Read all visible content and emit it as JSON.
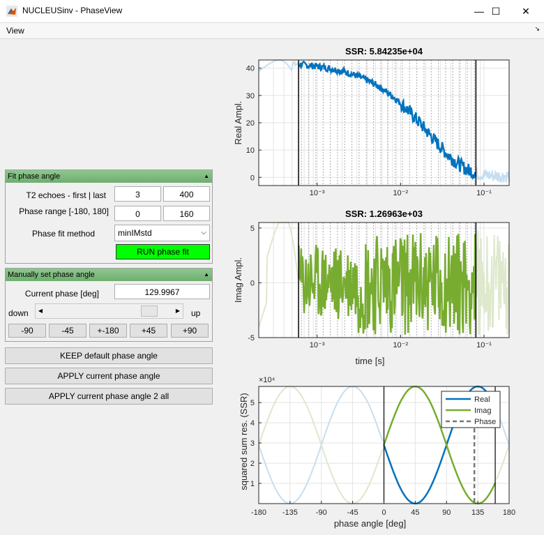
{
  "window": {
    "title": "NUCLEUSinv - PhaseView",
    "minimize_glyph": "—",
    "maximize_glyph": "☐",
    "close_glyph": "✕"
  },
  "menu": {
    "view_label": "View",
    "overflow_glyph": "↘"
  },
  "fit_panel": {
    "title": "Fit phase angle",
    "echoes_label": "T2 echoes - first | last",
    "echoes_first": "3",
    "echoes_last": "400",
    "range_label": "Phase range [-180, 180]",
    "range_min": "0",
    "range_max": "160",
    "method_label": "Phase fit method",
    "method_value": "minIMstd",
    "run_label": "RUN phase fit"
  },
  "manual_panel": {
    "title": "Manually set phase angle",
    "current_label": "Current phase [deg]",
    "current_value": "129.9967",
    "slider_level": 0.86,
    "down_label": "down",
    "up_label": "up",
    "step_buttons": [
      "-90",
      "-45",
      "+-180",
      "+45",
      "+90"
    ]
  },
  "actions": {
    "keep_label": "KEEP default phase angle",
    "apply_label": "APPLY current phase angle",
    "apply_all_label": "APPLY current phase angle 2 all"
  },
  "colors": {
    "real": "#0072bd",
    "imag": "#77ac30",
    "panel_header": "#7fbf7f",
    "run_button": "#00ff00"
  },
  "chart_data": [
    {
      "type": "line",
      "title": "SSR: 5.84235e+04",
      "ylabel": "Real Ampl.",
      "xscale": "log",
      "xlim": [
        0.0002,
        0.2
      ],
      "ylim": [
        -3,
        43
      ],
      "yticks": [
        "0",
        "10",
        "20",
        "30",
        "40"
      ],
      "xticks": [
        "10⁻³",
        "10⁻²",
        "10⁻¹"
      ],
      "window": [
        0.0006,
        0.08
      ],
      "series": [
        {
          "color": "#0072bd"
        }
      ]
    },
    {
      "type": "line",
      "title": "SSR: 1.26963e+03",
      "ylabel": "Imag Ampl.",
      "xlabel": "time [s]",
      "xscale": "log",
      "xlim": [
        0.0002,
        0.2
      ],
      "ylim": [
        -5,
        5.5
      ],
      "yticks": [
        "-5",
        "0",
        "5"
      ],
      "xticks": [
        "10⁻³",
        "10⁻²",
        "10⁻¹"
      ],
      "window": [
        0.0006,
        0.08
      ],
      "series": [
        {
          "color": "#77ac30"
        }
      ]
    },
    {
      "type": "line",
      "ylabel": "squared sum res. (SSR)",
      "xlabel": "phase angle [deg]",
      "exponent_label": "×10⁴",
      "xlim": [
        -180,
        180
      ],
      "ylim": [
        0,
        5.8
      ],
      "xticks": [
        "-180",
        "-135",
        "-90",
        "-45",
        "0",
        "45",
        "90",
        "135",
        "180"
      ],
      "yticks": [
        "1",
        "2",
        "3",
        "4",
        "5"
      ],
      "window": [
        0,
        160
      ],
      "current_phase": 130,
      "series": [
        {
          "name": "Real",
          "color": "#0072bd",
          "amplitude": 2.9,
          "offset": 2.9,
          "peak_deg": 135
        },
        {
          "name": "Imag",
          "color": "#77ac30",
          "amplitude": 2.9,
          "offset": 2.9,
          "peak_deg": 45
        },
        {
          "name": "Phase",
          "color": "#777777",
          "style": "dashed"
        }
      ]
    }
  ]
}
